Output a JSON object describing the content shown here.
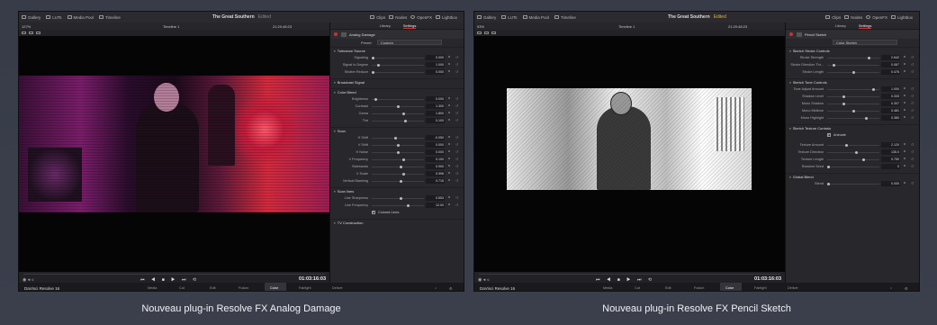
{
  "screens": [
    {
      "topbar": {
        "gallery": "Gallery",
        "luts": "LUTs",
        "media_pool": "Media Pool",
        "timeline": "Timeline",
        "project": "The Great Southern",
        "status": "Edited",
        "clips": "Clips",
        "nodes": "Nodes",
        "openfx": "OpenFX",
        "lightbox": "Lightbox"
      },
      "viewer": {
        "zoom": "127%",
        "timeline_name": "Timeline 1",
        "timecode": "21:20:48:23",
        "playhead": "01:03:16:03"
      },
      "panel": {
        "tab_library": "Library",
        "tab_settings": "Settings",
        "effect": "Analog Damage",
        "preset_label": "Preset",
        "preset_value": "Custom"
      },
      "sections": [
        {
          "title": "Tolerance Source",
          "rows": [
            {
              "label": "Signaling",
              "value": "0.000",
              "pos": 0.0
            },
            {
              "label": "Signal to Degree",
              "value": "1.000",
              "pos": 0.1
            },
            {
              "label": "Shutter Reduce",
              "value": "0.000",
              "pos": 0.0
            }
          ]
        },
        {
          "title": "Broadcast Signal",
          "rows": []
        },
        {
          "title": "Color Bleed",
          "rows": [
            {
              "label": "Brightness",
              "value": "0.000",
              "pos": 0.05
            },
            {
              "label": "Contrast",
              "value": "1.300",
              "pos": 0.5
            },
            {
              "label": "Gama",
              "value": "1.800",
              "pos": 0.6
            },
            {
              "label": "Tint",
              "value": "0.100",
              "pos": 0.65
            }
          ]
        },
        {
          "title": "Scan",
          "rows": [
            {
              "label": "H Shift",
              "value": "-0.050",
              "pos": 0.45
            },
            {
              "label": "V Shift",
              "value": "0.000",
              "pos": 0.5
            },
            {
              "label": "H Noise",
              "value": "0.000",
              "pos": 0.5
            },
            {
              "label": "V Frequency",
              "value": "0.100",
              "pos": 0.6
            },
            {
              "label": "Sidebands",
              "value": "0.900",
              "pos": 0.55
            },
            {
              "label": "V Scale",
              "value": "0.996",
              "pos": 0.6
            },
            {
              "label": "Vertical Blanking",
              "value": "0.715",
              "pos": 0.55
            }
          ]
        },
        {
          "title": "Scan lines",
          "rows": [
            {
              "label": "Line Sharpness",
              "value": "0.553",
              "pos": 0.55
            },
            {
              "label": "Line Frequency",
              "value": "12.00",
              "pos": 0.7
            }
          ],
          "checkbox": "Colored Lines"
        },
        {
          "title": "TV Construction",
          "rows": []
        }
      ],
      "pages": {
        "app": "DaVinci Resolve 16",
        "media": "Media",
        "cut": "Cut",
        "edit": "Edit",
        "fusion": "Fusion",
        "color": "Color",
        "fairlight": "Fairlight",
        "deliver": "Deliver"
      },
      "caption": "Nouveau plug-in Resolve FX Analog Damage"
    },
    {
      "topbar": {
        "gallery": "Gallery",
        "luts": "LUTs",
        "media_pool": "Media Pool",
        "timeline": "Timeline",
        "project": "The Great Southern",
        "status": "Edited",
        "clips": "Clips",
        "nodes": "Nodes",
        "openfx": "OpenFX",
        "lightbox": "Lightbox"
      },
      "viewer": {
        "zoom": "93%",
        "timeline_name": "Timeline 1",
        "timecode": "21:20:48:23",
        "playhead": "01:03:16:03"
      },
      "panel": {
        "tab_library": "Library",
        "tab_settings": "Settings",
        "effect": "Pencil Sketch",
        "preset_label": "",
        "preset_value": "Color Sketch"
      },
      "sections": [
        {
          "title": "Sketch Stroke Controls",
          "rows": [
            {
              "label": "Stroke Strength",
              "value": "2.642",
              "pos": 0.8
            },
            {
              "label": "Stroke Direction Thr...",
              "value": "0.067",
              "pos": 0.1
            },
            {
              "label": "Stroke Length",
              "value": "0.476",
              "pos": 0.5
            }
          ]
        },
        {
          "title": "Sketch Tone Controls",
          "rows": [
            {
              "label": "Tone Adjust Amount",
              "value": "1.000",
              "pos": 0.9
            },
            {
              "label": "Shadow Level",
              "value": "0.333",
              "pos": 0.3
            },
            {
              "label": "Mono Shadow",
              "value": "0.307",
              "pos": 0.3
            },
            {
              "label": "Mono Midtone",
              "value": "0.481",
              "pos": 0.5
            },
            {
              "label": "Mono Highlight",
              "value": "0.380",
              "pos": 0.75
            }
          ]
        },
        {
          "title": "Sketch Texture Controls",
          "rows": [],
          "checkbox": "Animate"
        },
        {
          "title": "",
          "rows": [
            {
              "label": "Texture Amount",
              "value": "2.120",
              "pos": 0.35
            },
            {
              "label": "Texture Direction",
              "value": "135.0",
              "pos": 0.55
            },
            {
              "label": "Texture Length",
              "value": "0.750",
              "pos": 0.7
            },
            {
              "label": "Random Seed",
              "value": "0",
              "pos": 0.0
            }
          ]
        },
        {
          "title": "Global Blend",
          "rows": [
            {
              "label": "Blend",
              "value": "0.000",
              "pos": 0.0
            }
          ]
        }
      ],
      "pages": {
        "app": "DaVinci Resolve 16",
        "media": "Media",
        "cut": "Cut",
        "edit": "Edit",
        "fusion": "Fusion",
        "color": "Color",
        "fairlight": "Fairlight",
        "deliver": "Deliver"
      },
      "caption": "Nouveau plug-in Resolve FX Pencil Sketch"
    }
  ]
}
